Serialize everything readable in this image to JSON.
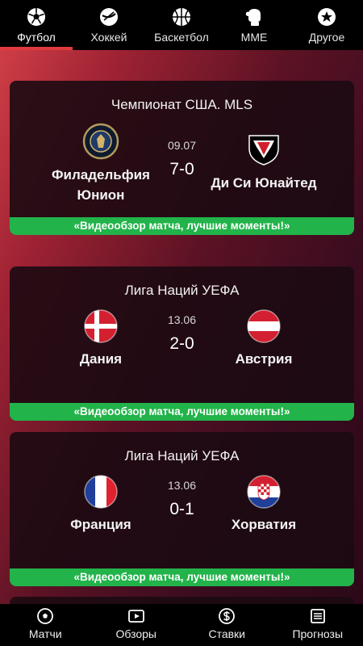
{
  "tabs": [
    {
      "label": "Футбол",
      "icon": "soccer-ball-icon",
      "active": true
    },
    {
      "label": "Хоккей",
      "icon": "hockey-puck-icon",
      "active": false
    },
    {
      "label": "Баскетбол",
      "icon": "basketball-icon",
      "active": false
    },
    {
      "label": "MME",
      "icon": "boxing-glove-icon",
      "active": false
    },
    {
      "label": "Другое",
      "icon": "star-icon",
      "active": false
    }
  ],
  "matches": [
    {
      "league": "Чемпионат США. MLS",
      "date": "09.07",
      "score": "7-0",
      "home": {
        "name": "Филадельфия Юнион",
        "logo": "philadelphia-union-logo"
      },
      "away": {
        "name": "Ди Си Юнайтед",
        "logo": "dc-united-logo"
      },
      "video": "«Видеообзор матча, лучшие моменты!»"
    },
    {
      "league": "Лига Наций УЕФА",
      "date": "13.06",
      "score": "2-0",
      "home": {
        "name": "Дания",
        "logo": "denmark-flag"
      },
      "away": {
        "name": "Австрия",
        "logo": "austria-flag"
      },
      "video": "«Видеообзор матча, лучшие моменты!»"
    },
    {
      "league": "Лига Наций УЕФА",
      "date": "13.06",
      "score": "0-1",
      "home": {
        "name": "Франция",
        "logo": "france-flag"
      },
      "away": {
        "name": "Хорватия",
        "logo": "croatia-flag"
      },
      "video": "«Видеообзор матча, лучшие моменты!»"
    }
  ],
  "bottom_nav": [
    {
      "label": "Матчи",
      "icon": "soccer-ball-icon"
    },
    {
      "label": "Обзоры",
      "icon": "play-icon"
    },
    {
      "label": "Ставки",
      "icon": "dollar-icon"
    },
    {
      "label": "Прогнозы",
      "icon": "list-icon"
    }
  ],
  "colors": {
    "accent": "#e0393e",
    "video_bar": "#22b34a",
    "bar_bg": "#000000"
  }
}
